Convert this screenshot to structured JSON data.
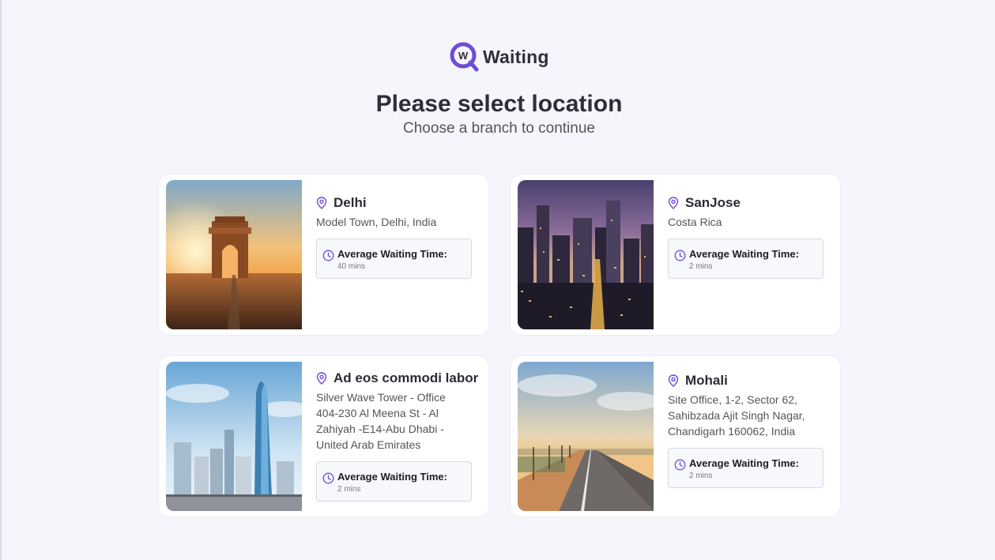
{
  "app": {
    "logo_text": "Waiting",
    "logo_letter": "W"
  },
  "header": {
    "title": "Please select location",
    "subtitle": "Choose a branch to continue"
  },
  "colors": {
    "accent": "#6c4cd8",
    "card_bg": "#ffffff",
    "page_bg": "#f5f5fc"
  },
  "locations": [
    {
      "name": "Delhi",
      "address": "Model Town, Delhi, India",
      "wait_label": "Average Waiting Time:",
      "wait_value": "40 mins",
      "image": "india-gate-sunset"
    },
    {
      "name": "SanJose",
      "address": "Costa Rica",
      "wait_label": "Average Waiting Time:",
      "wait_value": "2 mins",
      "image": "city-skyline-night"
    },
    {
      "name": "Ad eos commodi labor",
      "address": "Silver Wave Tower - Office 404-230 Al Meena St - Al Zahiyah -E14-Abu Dhabi - United Arab Emirates",
      "wait_label": "Average Waiting Time:",
      "wait_value": "2 mins",
      "image": "glass-skyscraper"
    },
    {
      "name": "Mohali",
      "address": "Site Office, 1-2, Sector 62, Sahibzada Ajit Singh Nagar, Chandigarh 160062, India",
      "wait_label": "Average Waiting Time:",
      "wait_value": "2 mins",
      "image": "boulevard-road"
    }
  ]
}
